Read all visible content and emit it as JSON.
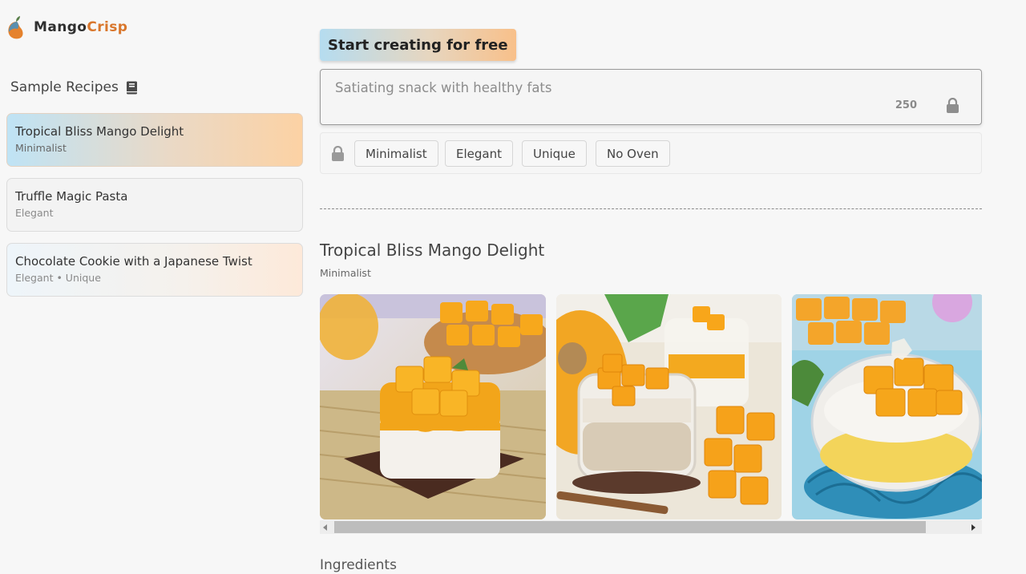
{
  "brand": {
    "name_part1": "Mango",
    "name_part2": "Crisp",
    "accent": "#d9772d"
  },
  "sidebar": {
    "title": "Sample Recipes",
    "title_icon": "book-icon",
    "recipes": [
      {
        "name": "Tropical Bliss Mango Delight",
        "tags": "Minimalist",
        "active": true
      },
      {
        "name": "Truffle Magic Pasta",
        "tags": "Elegant",
        "active": false
      },
      {
        "name": "Chocolate Cookie with a Japanese Twist",
        "tags": "Elegant • Unique",
        "active": false
      }
    ]
  },
  "main": {
    "cta_label": "Start creating for free",
    "prompt": {
      "text": "Satiating snack with healthy fats",
      "char_count": "250",
      "icon": "lock-icon"
    },
    "tags": [
      "Minimalist",
      "Elegant",
      "Unique",
      "No Oven"
    ],
    "tags_icon": "lock-icon",
    "result": {
      "title": "Tropical Bliss Mango Delight",
      "tags": "Minimalist",
      "photos": [
        "mango-layered-dessert-photo",
        "mango-rice-pudding-photo",
        "mango-yogurt-bowl-photo"
      ]
    },
    "ingredients_heading": "Ingredients"
  },
  "colors": {
    "mango": "#f5a623",
    "gradient_blue": "#b5dcf0",
    "gradient_orange": "#f8c08a"
  }
}
